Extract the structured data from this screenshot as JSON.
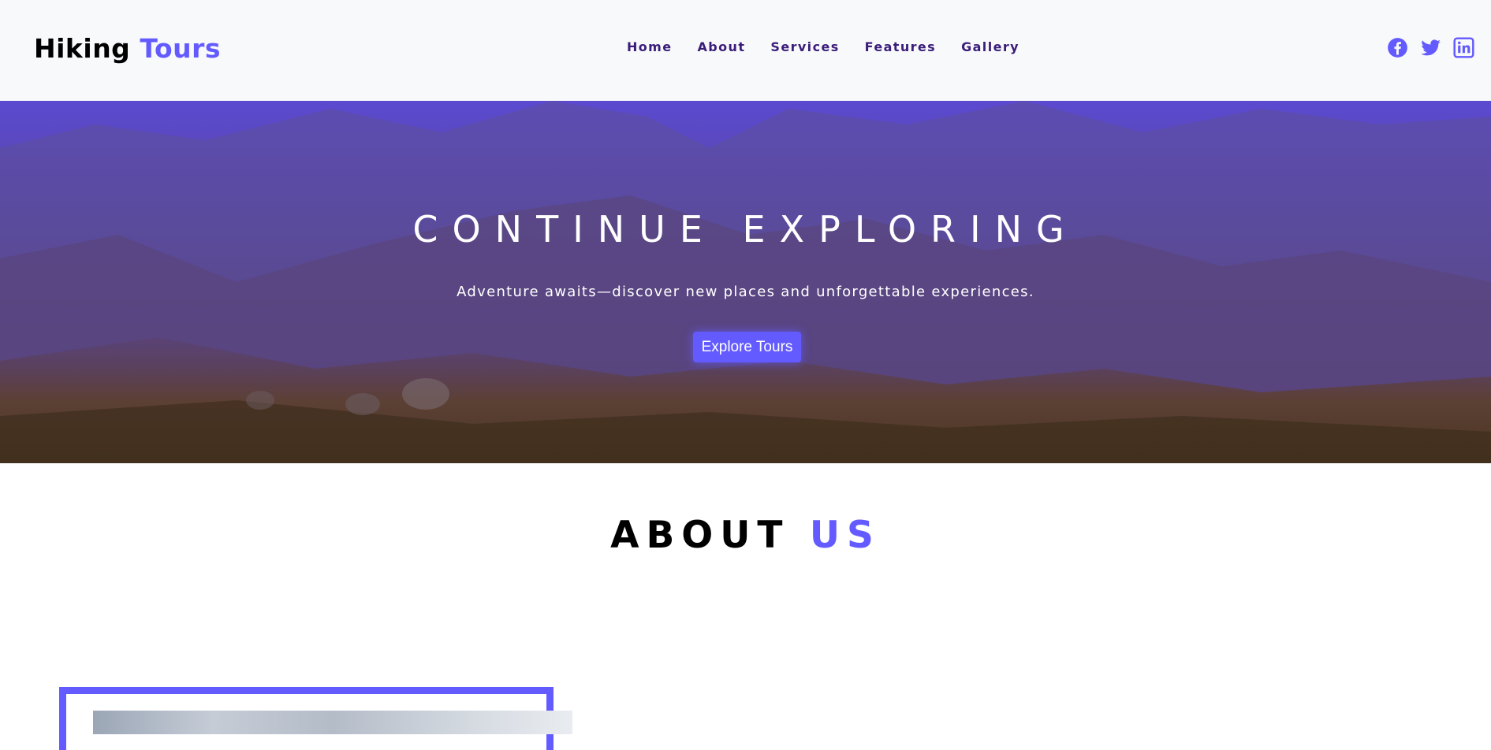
{
  "header": {
    "logo_main": "Hiking",
    "logo_accent": "Tours",
    "nav": [
      "Home",
      "About",
      "Services",
      "Features",
      "Gallery"
    ],
    "social": [
      "facebook-icon",
      "twitter-icon",
      "linkedin-icon"
    ]
  },
  "hero": {
    "title": "CONTINUE EXPLORING",
    "subtitle": "Adventure awaits—discover new places and unforgettable experiences.",
    "button": "Explore Tours"
  },
  "about": {
    "title_main": "ABOUT",
    "title_accent": "US"
  },
  "colors": {
    "accent": "#635bff",
    "nav_text": "#3a1d7a",
    "header_bg": "#f8f9fa"
  }
}
